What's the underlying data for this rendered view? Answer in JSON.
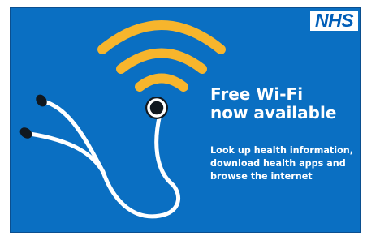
{
  "logo": {
    "text": "NHS"
  },
  "headline": {
    "lines": [
      "Free Wi-Fi",
      "now available"
    ]
  },
  "body": {
    "lines": [
      "Look up health information,",
      "download health apps and",
      "browse the internet"
    ]
  },
  "icons": {
    "wifi": "wifi-signal-icon",
    "stethoscope": "stethoscope-icon"
  },
  "colors": {
    "background": "#0a6fc2",
    "wifi_arcs": "#f7b52c",
    "text": "#ffffff",
    "logo_text": "#005eb8"
  }
}
